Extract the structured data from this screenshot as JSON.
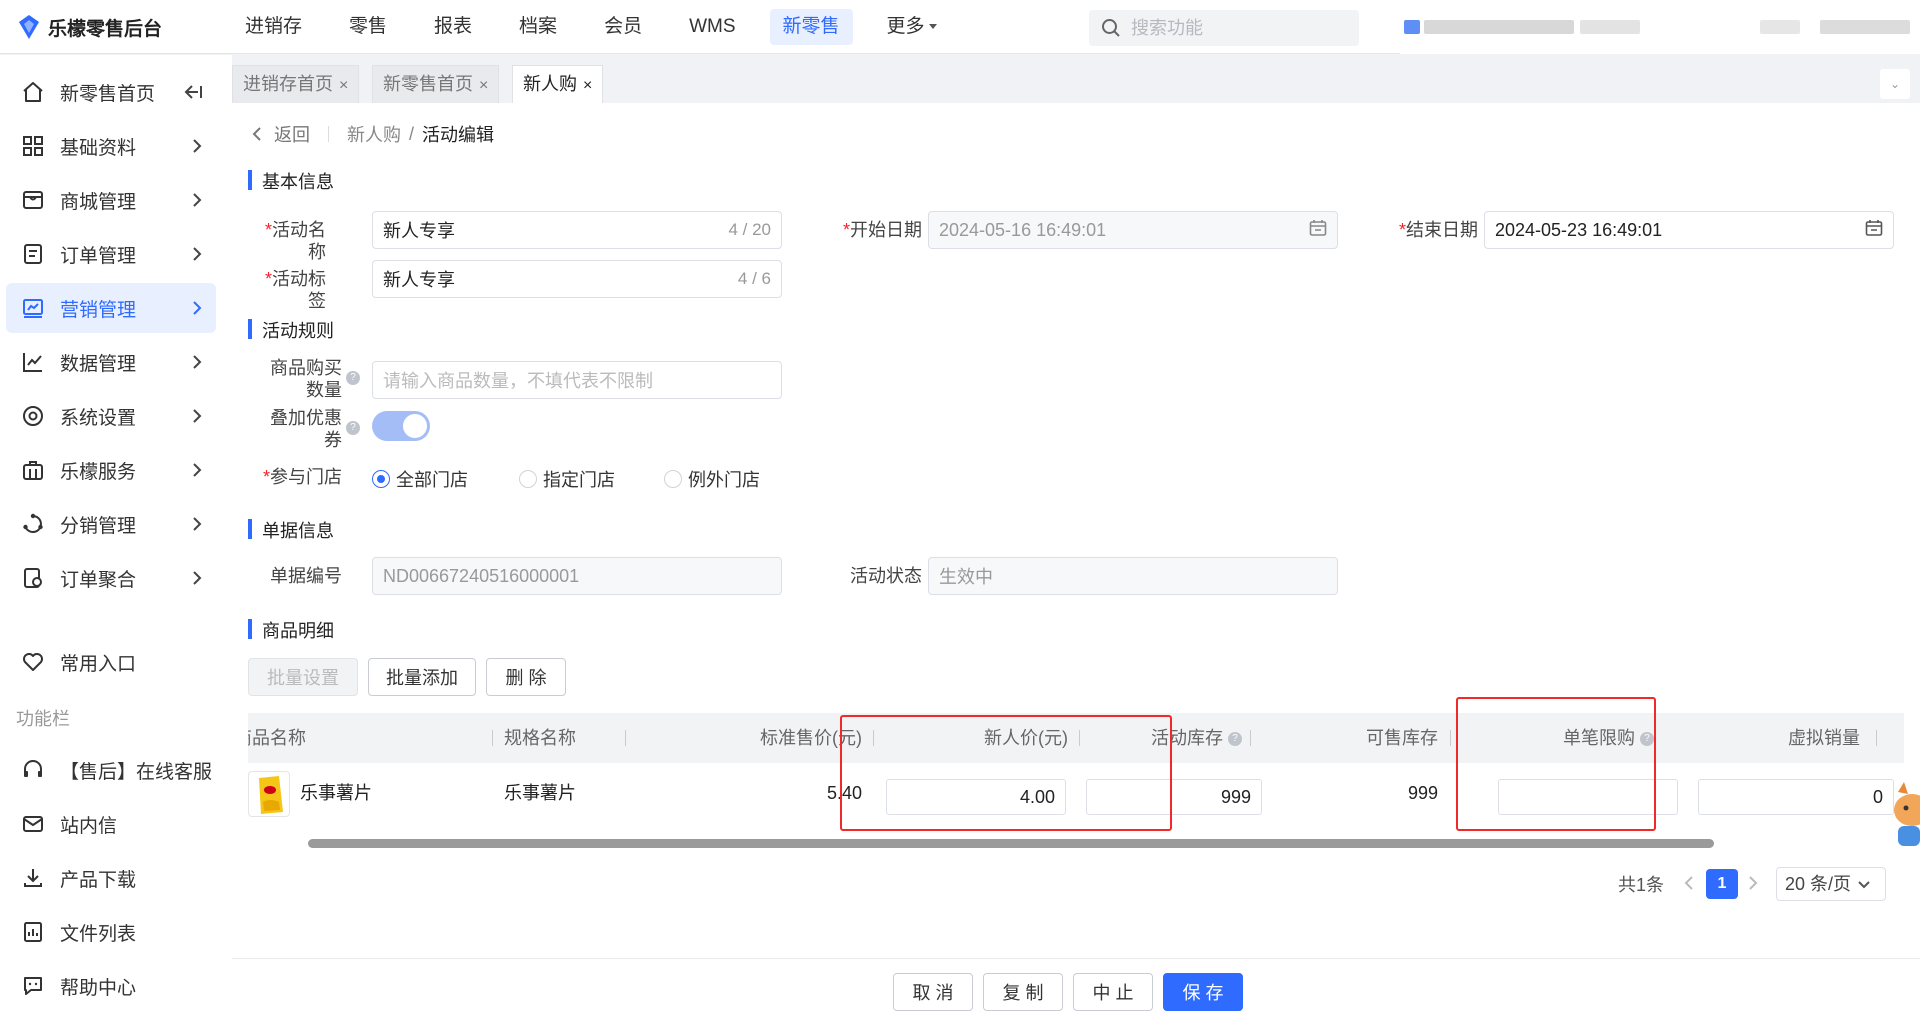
{
  "app": {
    "logo_text": "乐檬零售后台"
  },
  "topnav": {
    "items": [
      "进销存",
      "零售",
      "报表",
      "档案",
      "会员",
      "WMS",
      "新零售",
      "更多"
    ],
    "active": "新零售",
    "search_placeholder": "搜索功能"
  },
  "sidebar": {
    "items": [
      {
        "label": "新零售首页",
        "icon": "home-icon"
      },
      {
        "label": "基础资料",
        "icon": "grid-icon"
      },
      {
        "label": "商城管理",
        "icon": "store-icon"
      },
      {
        "label": "订单管理",
        "icon": "order-icon"
      },
      {
        "label": "营销管理",
        "icon": "marketing-icon",
        "active": true
      },
      {
        "label": "数据管理",
        "icon": "chart-icon"
      },
      {
        "label": "系统设置",
        "icon": "settings-icon"
      },
      {
        "label": "乐檬服务",
        "icon": "service-icon"
      },
      {
        "label": "分销管理",
        "icon": "distribution-icon"
      },
      {
        "label": "订单聚合",
        "icon": "aggregate-icon"
      }
    ],
    "favorites_label": "常用入口",
    "toolbar_title": "功能栏",
    "tools": [
      {
        "label": "【售后】在线客服",
        "icon": "headset-icon"
      },
      {
        "label": "站内信",
        "icon": "mail-icon"
      },
      {
        "label": "产品下载",
        "icon": "download-icon"
      },
      {
        "label": "文件列表",
        "icon": "file-list-icon"
      },
      {
        "label": "帮助中心",
        "icon": "help-chat-icon"
      }
    ]
  },
  "tabs": [
    {
      "label": "进销存首页"
    },
    {
      "label": "新零售首页"
    },
    {
      "label": "新人购",
      "active": true
    }
  ],
  "breadcrumb": {
    "back": "返回",
    "parent": "新人购",
    "sep": "/",
    "current": "活动编辑"
  },
  "basic": {
    "title": "基本信息",
    "name_label": "活动名称",
    "name_value": "新人专享",
    "name_count": "4 / 20",
    "tag_label": "活动标签",
    "tag_value": "新人专享",
    "tag_count": "4 / 6",
    "start_label": "开始日期",
    "start_value": "2024-05-16 16:49:01",
    "end_label": "结束日期",
    "end_value": "2024-05-23 16:49:01"
  },
  "rules": {
    "title": "活动规则",
    "qty_label_1": "商品购买",
    "qty_label_2": "数量",
    "qty_placeholder": "请输入商品数量，不填代表不限制",
    "coupon_label_1": "叠加优惠",
    "coupon_label_2": "券",
    "coupon_on": true,
    "store_label": "参与门店",
    "store_options": [
      "全部门店",
      "指定门店",
      "例外门店"
    ],
    "store_selected": "全部门店"
  },
  "doc": {
    "title": "单据信息",
    "no_label": "单据编号",
    "no_value": "ND00667240516000001",
    "status_label": "活动状态",
    "status_value": "生效中"
  },
  "goods": {
    "title": "商品明细",
    "btn_batch_set": "批量设置",
    "btn_batch_add": "批量添加",
    "btn_delete": "删 除",
    "columns": [
      "商品名称",
      "规格名称",
      "标准售价(元)",
      "新人价(元)",
      "活动库存",
      "可售库存",
      "单笔限购",
      "虚拟销量"
    ],
    "rows": [
      {
        "name": "乐事薯片",
        "spec": "乐事薯片",
        "price": "5.40",
        "new_price": "4.00",
        "stock": "999",
        "sellable": "999",
        "limit": "",
        "virtual_sales": "0"
      }
    ]
  },
  "pagination": {
    "total": "共1条",
    "page": "1",
    "page_size": "20 条/页"
  },
  "footer": {
    "cancel": "取 消",
    "copy": "复 制",
    "stop": "中 止",
    "save": "保 存"
  },
  "colors": {
    "accent": "#2f6bff",
    "highlight": "#f02a2a",
    "required": "#f5222d"
  }
}
